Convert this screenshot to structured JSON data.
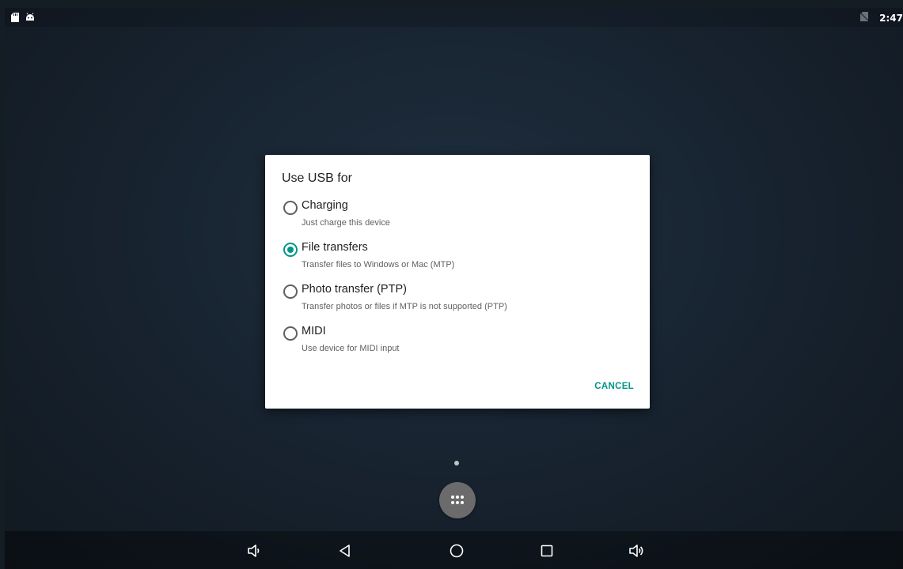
{
  "status_bar": {
    "left_icons": [
      "sd-card-icon",
      "android-debug-icon"
    ],
    "right_icons": [
      "no-sim-icon"
    ],
    "time": "2:47"
  },
  "dialog": {
    "title": "Use USB for",
    "selected_option": "File transfers",
    "options": [
      {
        "title": "Charging",
        "description": "Just charge this device",
        "checked": false
      },
      {
        "title": "File transfers",
        "description": "Transfer files to Windows or Mac (MTP)",
        "checked": true
      },
      {
        "title": "Photo transfer (PTP)",
        "description": "Transfer photos or files if MTP is not supported (PTP)",
        "checked": false
      },
      {
        "title": "MIDI",
        "description": "Use device for MIDI input",
        "checked": false
      }
    ],
    "cancel_label": "CANCEL",
    "accent_color": "#009688"
  },
  "home": {
    "page_indicator_count": 1,
    "app_drawer_icon": "all-apps-icon"
  },
  "nav_bar": {
    "buttons": [
      "volume-down-icon",
      "back-icon",
      "home-icon",
      "recents-icon",
      "volume-up-icon"
    ]
  }
}
